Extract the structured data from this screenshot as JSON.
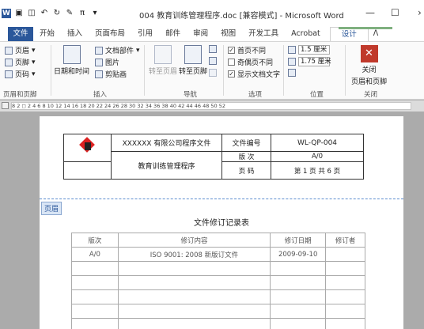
{
  "window": {
    "title": "004 教育训练管理程序.doc [兼容模式] - Microsoft Word",
    "qat_icons": [
      "word-app-icon",
      "save-icon",
      "print-preview-icon",
      "undo-icon",
      "redo-icon",
      "format-painter-icon",
      "pi-symbol-icon",
      "customize-qat-icon"
    ],
    "minimize": "—",
    "maximize": "☐",
    "close": "›"
  },
  "tabs": [
    "文件",
    "开始",
    "插入",
    "页面布局",
    "引用",
    "邮件",
    "审阅",
    "视图",
    "开发工具",
    "Acrobat",
    "设计"
  ],
  "tabs_extra": "ᐱ",
  "ribbon": {
    "hf": {
      "header": "页眉",
      "footer": "页脚",
      "page_number": "页码",
      "label": "页眉和页脚"
    },
    "insert": {
      "datetime": "日期和时间",
      "docparts": "文档部件",
      "picture": "图片",
      "clipart": "剪贴画",
      "label": "插入"
    },
    "nav": {
      "goto_header": "转至页眉",
      "goto_footer": "转至页脚",
      "label": "导航"
    },
    "options": {
      "first_page": "首页不同",
      "odd_even": "奇偶页不同",
      "show_text": "显示文档文字",
      "first_page_checked": true,
      "odd_even_checked": false,
      "show_text_checked": true,
      "label": "选项"
    },
    "position": {
      "header_dist": "1.5 厘米",
      "footer_dist": "1.75 厘米",
      "label": "位置"
    },
    "close": {
      "button": "关闭\n页眉和页脚",
      "line1": "关闭",
      "line2": "页眉和页脚",
      "label": "关闭"
    }
  },
  "ruler": "8  2  ◻  2  4  6  8  10  12  14  16  18  20  22  24  26  28  30  32  34  36  38  40  42  44  46  48  50  52",
  "document": {
    "header": {
      "company": "XXXXXX 有限公司程序文件",
      "doc_no_label": "文件编号",
      "doc_no": "WL-QP-004",
      "doc_name": "教育训练管理程序",
      "version_label": "版  次",
      "version": "A/0",
      "page_label": "页  码",
      "page": "第 1 页 共 6 页"
    },
    "header_tag": "页眉",
    "title": "文件修订记录表",
    "revision_table": {
      "columns": [
        "版次",
        "修订内容",
        "修订日期",
        "修订者"
      ],
      "rows": [
        [
          "A/0",
          "ISO 9001: 2008 新版订文件",
          "2009-09-10",
          ""
        ],
        [
          "",
          "",
          "",
          ""
        ],
        [
          "",
          "",
          "",
          ""
        ],
        [
          "",
          "",
          "",
          ""
        ],
        [
          "",
          "",
          "",
          ""
        ],
        [
          "",
          "",
          "",
          ""
        ]
      ]
    }
  }
}
